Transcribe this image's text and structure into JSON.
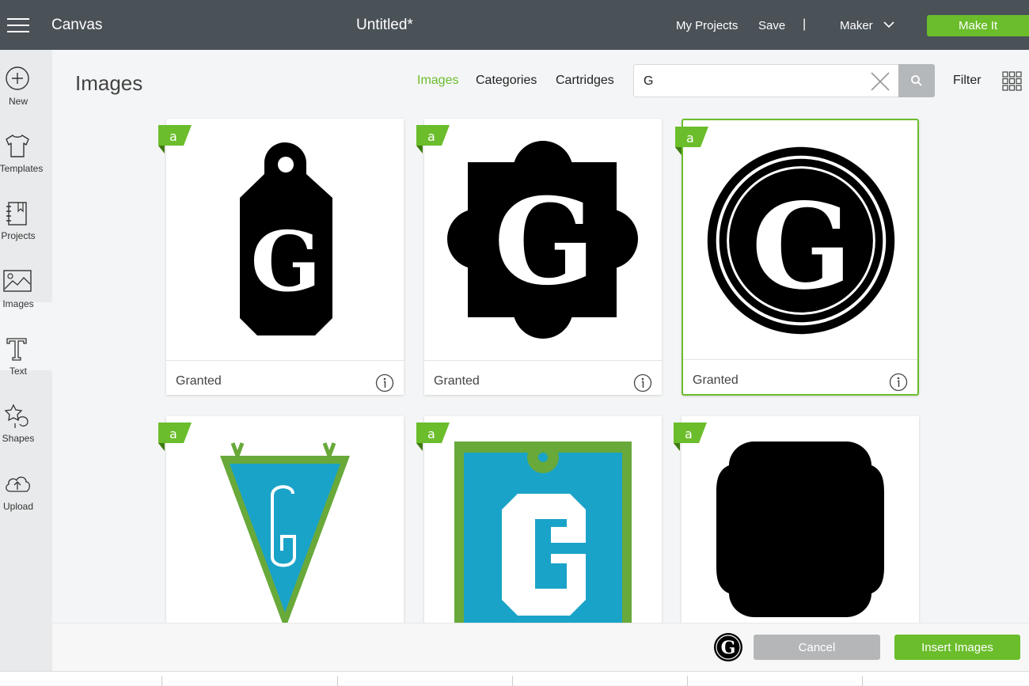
{
  "topbar": {
    "app_title": "Canvas",
    "document_title": "Untitled*",
    "my_projects": "My Projects",
    "save": "Save",
    "separator": "|",
    "machine": "Maker",
    "make_it": "Make It"
  },
  "sidebar": {
    "items": [
      {
        "label": "New",
        "icon": "plus-circle-icon"
      },
      {
        "label": "Templates",
        "icon": "tshirt-icon"
      },
      {
        "label": "Projects",
        "icon": "notebook-icon"
      },
      {
        "label": "Images",
        "icon": "image-icon",
        "active": true
      },
      {
        "label": "Text",
        "icon": "text-icon"
      },
      {
        "label": "Shapes",
        "icon": "shapes-icon"
      },
      {
        "label": "Upload",
        "icon": "cloud-upload-icon"
      }
    ]
  },
  "main": {
    "title": "Images",
    "tabs": [
      {
        "label": "Images",
        "active": true
      },
      {
        "label": "Categories"
      },
      {
        "label": "Cartridges"
      }
    ],
    "search": {
      "value": "G"
    },
    "filter": "Filter"
  },
  "cards": [
    {
      "label": "Granted",
      "image": "g-tag-icon"
    },
    {
      "label": "Granted",
      "image": "g-quatrefoil-icon"
    },
    {
      "label": "Granted",
      "image": "g-circle-seal-icon",
      "selected": true
    },
    {
      "label": "",
      "image": "g-pennant-icon"
    },
    {
      "label": "",
      "image": "g-blue-tag-icon"
    },
    {
      "label": "",
      "image": "black-plaque-icon"
    }
  ],
  "action_bar": {
    "cancel": "Cancel",
    "insert": "Insert Images"
  },
  "colors": {
    "accent": "#6bbd2b",
    "topbar": "#4a5157",
    "blue_fill": "#1aa3c8",
    "green_frame": "#68a93a"
  }
}
